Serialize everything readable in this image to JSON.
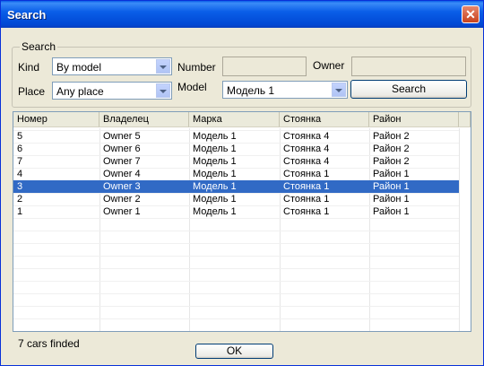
{
  "window": {
    "title": "Search",
    "close_glyph": "✕"
  },
  "search_group": {
    "legend": "Search",
    "kind_label": "Kind",
    "kind_value": "By model",
    "place_label": "Place",
    "place_value": "Any place",
    "number_label": "Number",
    "number_value": "",
    "owner_label": "Owner",
    "owner_value": "",
    "model_label": "Model",
    "model_value": "Модель 1",
    "search_button": "Search"
  },
  "results": {
    "columns": [
      "Номер",
      "Владелец",
      "Марка",
      "Стоянка",
      "Район"
    ],
    "rows": [
      [
        "5",
        "Owner 5",
        "Модель 1",
        "Стоянка 4",
        "Район 2"
      ],
      [
        "6",
        "Owner 6",
        "Модель 1",
        "Стоянка 4",
        "Район 2"
      ],
      [
        "7",
        "Owner 7",
        "Модель 1",
        "Стоянка 4",
        "Район 2"
      ],
      [
        "4",
        "Owner 4",
        "Модель 1",
        "Стоянка 1",
        "Район 1"
      ],
      [
        "3",
        "Owner 3",
        "Модель 1",
        "Стоянка 1",
        "Район 1"
      ],
      [
        "2",
        "Owner 2",
        "Модель 1",
        "Стоянка 1",
        "Район 1"
      ],
      [
        "1",
        "Owner 1",
        "Модель 1",
        "Стоянка 1",
        "Район 1"
      ]
    ],
    "selected_row": 4
  },
  "status_text": "7 cars finded",
  "ok_button": "OK",
  "colors": {
    "titlebar": "#0a5ee8",
    "selection": "#316ac5",
    "dialog_bg": "#ece9d8"
  }
}
